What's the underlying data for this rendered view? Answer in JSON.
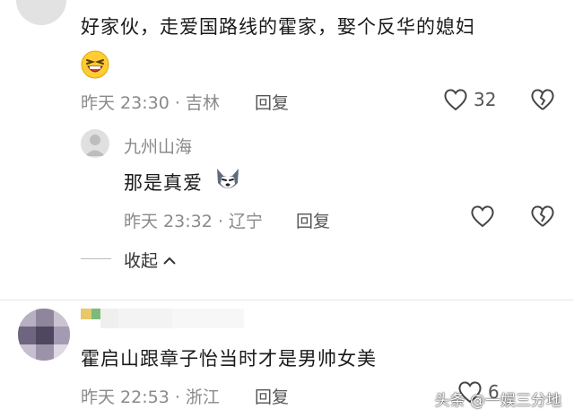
{
  "comment1": {
    "text": "好家伙，走爱国路线的霍家，娶个反华的媳妇",
    "time": "昨天 23:30",
    "location": "吉林",
    "reply_label": "回复",
    "like_count": "32",
    "emoji": "laughing-face"
  },
  "reply1": {
    "username": "九州山海",
    "text": "那是真爱",
    "emoji": "husky-face",
    "time": "昨天 23:32",
    "location": "辽宁",
    "reply_label": "回复"
  },
  "collapse": {
    "label": "收起"
  },
  "comment2": {
    "text": "霍启山跟章子怡当时才是男帅女美",
    "time": "昨天 22:53",
    "location": "浙江",
    "reply_label": "回复",
    "like_count": "6"
  },
  "watermark": {
    "text": "头条 @一娱三分地"
  },
  "colors": {
    "text": "#1a1a1a",
    "meta": "#8a8a8a",
    "emoji_yellow": "#ffcc33",
    "emoji_red": "#e53935"
  }
}
